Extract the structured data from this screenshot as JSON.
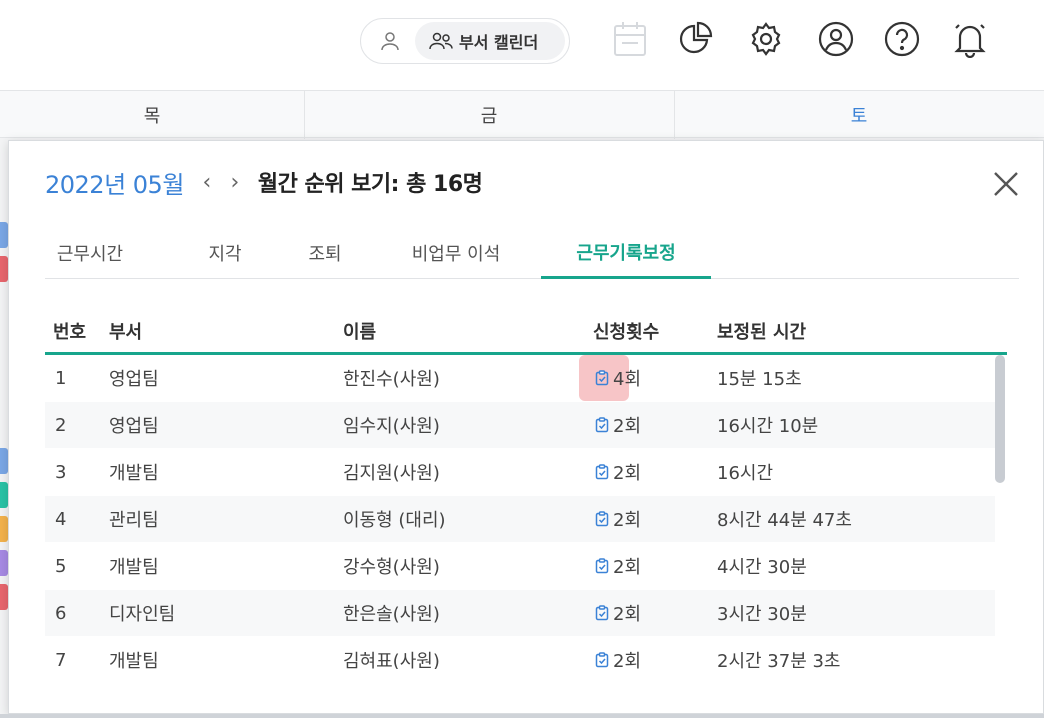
{
  "topbar": {
    "dept_calendar_label": "부서 캘린더",
    "icons": [
      "person-icon",
      "group-icon",
      "calendar-icon",
      "pie-chart-icon",
      "gear-icon",
      "user-circle-icon",
      "help-icon",
      "bell-icon"
    ]
  },
  "weekdays": {
    "thu": "목",
    "fri": "금",
    "sat": "토"
  },
  "colors": {
    "accent": "#17a58c",
    "date": "#3b82d6",
    "saturday": "#3b82d6",
    "highlight": "#f7c5c7"
  },
  "modal": {
    "date": "2022년 05월",
    "prev": "‹",
    "next": "›",
    "heading": "월간 순위 보기: 총 16명",
    "tabs": [
      "근무시간",
      "지각",
      "조퇴",
      "비업무 이석",
      "근무기록보정"
    ],
    "active_tab": 4,
    "columns": {
      "no": "번호",
      "dept": "부서",
      "name": "이름",
      "count": "신청횟수",
      "time": "보정된 시간"
    },
    "rows": [
      {
        "no": "1",
        "dept": "영업팀",
        "name": "한진수(사원)",
        "count": "4회",
        "time": "15분 15초"
      },
      {
        "no": "2",
        "dept": "영업팀",
        "name": "임수지(사원)",
        "count": "2회",
        "time": "16시간 10분"
      },
      {
        "no": "3",
        "dept": "개발팀",
        "name": "김지원(사원)",
        "count": "2회",
        "time": "16시간"
      },
      {
        "no": "4",
        "dept": "관리팀",
        "name": "이동형 (대리)",
        "count": "2회",
        "time": "8시간 44분 47초"
      },
      {
        "no": "5",
        "dept": "개발팀",
        "name": "강수형(사원)",
        "count": "2회",
        "time": "4시간 30분"
      },
      {
        "no": "6",
        "dept": "디자인팀",
        "name": "한은솔(사원)",
        "count": "2회",
        "time": "3시간 30분"
      },
      {
        "no": "7",
        "dept": "개발팀",
        "name": "김혀표(사원)",
        "count": "2회",
        "time": "2시간 37분 3초"
      }
    ]
  }
}
